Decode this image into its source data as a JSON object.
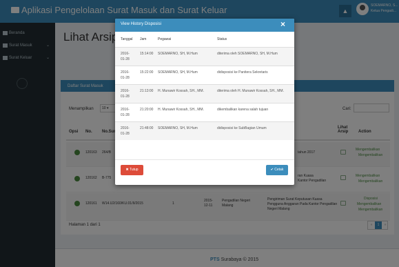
{
  "app": {
    "title": "Aplikasi Pengelolaan Surat Masuk dan Surat Keluar",
    "user_name": "SOEMARNO, S...",
    "user_role": "Ketua Pengadi..."
  },
  "sidebar": {
    "items": [
      {
        "label": "Beranda",
        "icon": "home-icon"
      },
      {
        "label": "Surat Masuk",
        "icon": "mail-icon"
      },
      {
        "label": "Surat Keluar",
        "icon": "mail-icon"
      }
    ]
  },
  "main": {
    "page_title": "Lihat Arsip N",
    "box_title": "Daftar Surat Masuk",
    "length_label": "Menampilkan",
    "length_value": "10",
    "search_label": "Cari:",
    "columns": [
      "Opsi",
      "No.",
      "No.Sur",
      "Lihat Arsip",
      "Action"
    ],
    "rows": [
      {
        "no": "120163",
        "nosur": "264/B",
        "extra": "tahun 2017",
        "actions": [
          "Mengembalikan",
          "Mengembalikan"
        ]
      },
      {
        "no": "120162",
        "nosur": "B-775",
        "extra": "ran Kuasa\nKantor Pengadilan",
        "actions": [
          "Mengembalikan",
          "Mengembalikan"
        ]
      },
      {
        "no": "120161",
        "nosur": "W14.U2/160/KU.01/II/2015",
        "one": "1",
        "date": "2015-\n12-11",
        "org": "Pengadilan Negeri\nMalang",
        "perihal": "Pengiriman Surat Keputusan Kuasa\nPengguna Anggaran Pada Kantor Pengadilan\nNegeri Malang",
        "actions": [
          "Disposisi",
          "Mengembalikan",
          "Mengembalikan"
        ]
      }
    ],
    "paging_info": "Halaman 1 dari 1",
    "page_current": "1"
  },
  "footer": {
    "brand": "PTS",
    "text": "Surabaya © 2015"
  },
  "modal": {
    "title": "View History Disposisi",
    "columns": [
      "Tanggal",
      "Jam",
      "Pegawai",
      "Status"
    ],
    "rows": [
      {
        "tanggal": "2016-01-28",
        "jam": "15:14:00",
        "pegawai": "SOEMARNO, SH, M.Hum",
        "status": "diterima oleh SOEMARNO, SH, M.Hum"
      },
      {
        "tanggal": "2016-01-28",
        "jam": "15:22:00",
        "pegawai": "SOEMARNO, SH, M.Hum",
        "status": "didisposisi ke Panitera Sekretaris"
      },
      {
        "tanggal": "2016-01-28",
        "jam": "21:13:00",
        "pegawai": "H. Munawir Kossah, SH., MM.",
        "status": "diterima oleh H. Munawir Kossah, SH., MM."
      },
      {
        "tanggal": "2016-01-28",
        "jam": "21:20:00",
        "pegawai": "H. Munawir Kossah, SH., MM.",
        "status": "dikembalikan karena salah tujuan"
      },
      {
        "tanggal": "2016-01-28",
        "jam": "21:48:00",
        "pegawai": "SOEMARNO, SH, M.Hum",
        "status": "didisposisi ke SubBagian Umum"
      }
    ],
    "close_label": "Tutup",
    "print_label": "Cetak"
  },
  "colors": {
    "primary": "#3c8dbc",
    "danger": "#dd4b39",
    "sidebar": "#222d32"
  }
}
